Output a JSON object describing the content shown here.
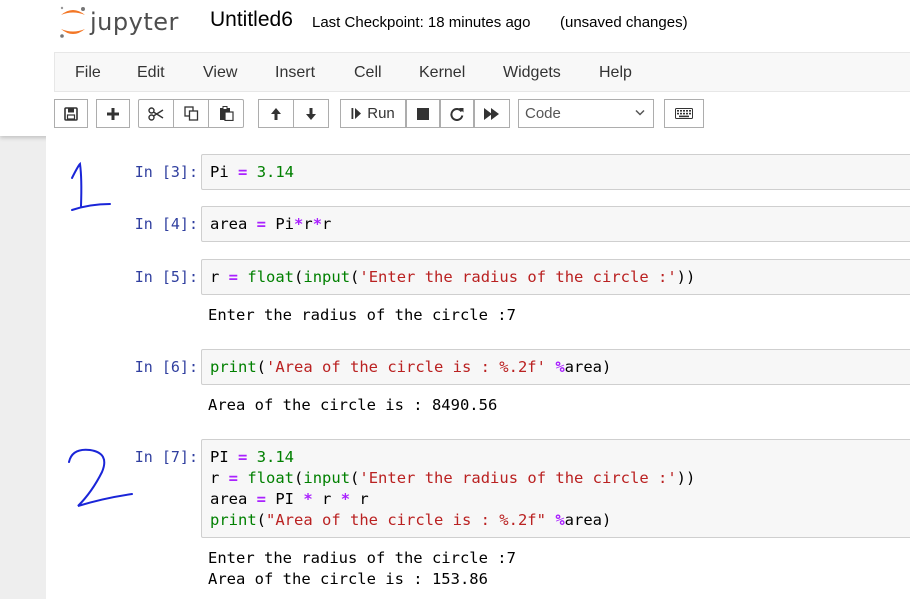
{
  "header": {
    "logo_text": "jupyter",
    "notebook_name": "Untitled6",
    "checkpoint": "Last Checkpoint: 18 minutes ago",
    "unsaved": "(unsaved changes)"
  },
  "menu": [
    "File",
    "Edit",
    "View",
    "Insert",
    "Cell",
    "Kernel",
    "Widgets",
    "Help"
  ],
  "toolbar": {
    "run_label": "Run",
    "cell_type": "Code",
    "icons": [
      "save-icon",
      "plus-icon",
      "cut-icon",
      "copy-icon",
      "paste-icon",
      "arrow-up-icon",
      "arrow-down-icon",
      "run-icon",
      "stop-icon",
      "restart-icon",
      "fast-forward-icon",
      "chevron-down-icon",
      "keyboard-icon"
    ]
  },
  "annotations": [
    "1",
    "2"
  ],
  "cells": [
    {
      "prompt": "In [3]:",
      "lines": [
        [
          [
            "Pi ",
            ""
          ],
          [
            "=",
            "op"
          ],
          [
            " ",
            ""
          ],
          [
            "3.14",
            "num"
          ]
        ]
      ],
      "output": []
    },
    {
      "prompt": "In [4]:",
      "lines": [
        [
          [
            "area ",
            ""
          ],
          [
            "=",
            "op"
          ],
          [
            " Pi",
            ""
          ],
          [
            "*",
            "op"
          ],
          [
            "r",
            ""
          ],
          [
            "*",
            "op"
          ],
          [
            "r",
            ""
          ]
        ]
      ],
      "output": []
    },
    {
      "prompt": "In [5]:",
      "lines": [
        [
          [
            "r ",
            ""
          ],
          [
            "=",
            "op"
          ],
          [
            " ",
            ""
          ],
          [
            "float",
            "bi"
          ],
          [
            "(",
            ""
          ],
          [
            "input",
            "bi"
          ],
          [
            "(",
            ""
          ],
          [
            "'Enter the radius of the circle :'",
            "str"
          ],
          [
            "))",
            ""
          ]
        ]
      ],
      "output": [
        "Enter the radius of the circle :7"
      ]
    },
    {
      "prompt": "In [6]:",
      "lines": [
        [
          [
            "print",
            "bi"
          ],
          [
            "(",
            ""
          ],
          [
            "'Area of the circle is : %.2f'",
            "str"
          ],
          [
            " ",
            ""
          ],
          [
            "%",
            "op"
          ],
          [
            "area)",
            ""
          ]
        ]
      ],
      "output": [
        "Area of the circle is : 8490.56"
      ]
    },
    {
      "prompt": "In [7]:",
      "lines": [
        [
          [
            "PI ",
            ""
          ],
          [
            "=",
            "op"
          ],
          [
            " ",
            ""
          ],
          [
            "3.14",
            "num"
          ]
        ],
        [
          [
            "r ",
            ""
          ],
          [
            "=",
            "op"
          ],
          [
            " ",
            ""
          ],
          [
            "float",
            "bi"
          ],
          [
            "(",
            ""
          ],
          [
            "input",
            "bi"
          ],
          [
            "(",
            ""
          ],
          [
            "'Enter the radius of the circle :'",
            "str"
          ],
          [
            "))",
            ""
          ]
        ],
        [
          [
            "area ",
            ""
          ],
          [
            "=",
            "op"
          ],
          [
            " PI ",
            ""
          ],
          [
            "*",
            "op"
          ],
          [
            " r ",
            ""
          ],
          [
            "*",
            "op"
          ],
          [
            " r",
            ""
          ]
        ],
        [
          [
            "print",
            "bi"
          ],
          [
            "(",
            ""
          ],
          [
            "\"Area of the circle is : %.2f\"",
            "str"
          ],
          [
            " ",
            ""
          ],
          [
            "%",
            "op"
          ],
          [
            "area)",
            ""
          ]
        ]
      ],
      "output": [
        "Enter the radius of the circle :7",
        "Area of the circle is : 153.86"
      ]
    }
  ]
}
